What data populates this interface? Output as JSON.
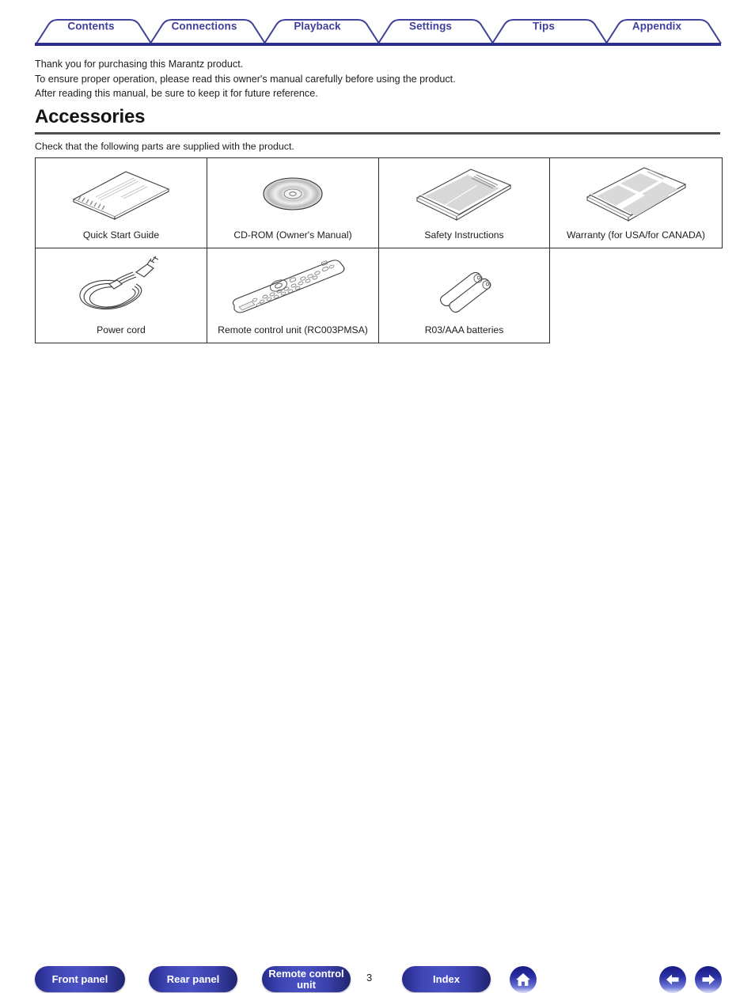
{
  "tabs": [
    {
      "label": "Contents",
      "name": "tab-contents"
    },
    {
      "label": "Connections",
      "name": "tab-connections"
    },
    {
      "label": "Playback",
      "name": "tab-playback"
    },
    {
      "label": "Settings",
      "name": "tab-settings"
    },
    {
      "label": "Tips",
      "name": "tab-tips"
    },
    {
      "label": "Appendix",
      "name": "tab-appendix"
    }
  ],
  "intro": {
    "line1": "Thank you for purchasing this Marantz product.",
    "line2": "To ensure proper operation, please read this owner's manual carefully before using the product.",
    "line3": "After reading this manual, be sure to keep it for future reference."
  },
  "heading": "Accessories",
  "subtext": "Check that the following parts are supplied with the product.",
  "accessories": [
    [
      {
        "label": "Quick Start Guide",
        "art": "booklet"
      },
      {
        "label": "CD-ROM (Owner's Manual)",
        "art": "cd"
      },
      {
        "label": "Safety Instructions",
        "art": "sheet"
      },
      {
        "label": "Warranty (for USA/for CANADA)",
        "art": "warranty"
      }
    ],
    [
      {
        "label": "Power cord",
        "art": "cord"
      },
      {
        "label": "Remote control unit (RC003PMSA)",
        "art": "remote"
      },
      {
        "label": "R03/AAA batteries",
        "art": "batteries"
      },
      {
        "label": "",
        "art": "none"
      }
    ]
  ],
  "footer": {
    "front_panel": "Front panel",
    "rear_panel": "Rear panel",
    "remote_control_unit_line1": "Remote control",
    "remote_control_unit_line2": "unit",
    "index": "Index",
    "page_number": "3",
    "home_icon": "home-icon",
    "back_icon": "arrow-left-icon",
    "forward_icon": "arrow-right-icon"
  },
  "colors": {
    "tab_text": "#3f3f9c",
    "tab_outline": "#3f3f9c",
    "tab_underline": "#2d2f8f",
    "pill_blue": "#3f46b4",
    "rule_gray": "#4d4d4d"
  }
}
